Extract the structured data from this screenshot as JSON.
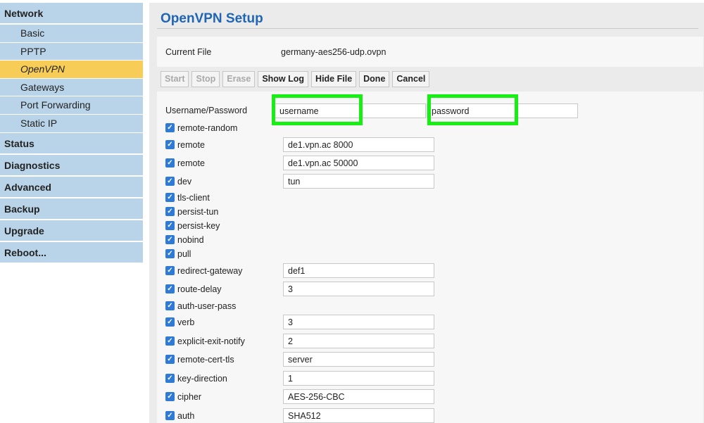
{
  "sidebar": {
    "network": "Network",
    "network_items": [
      {
        "label": "Basic"
      },
      {
        "label": "PPTP"
      },
      {
        "label": "OpenVPN"
      },
      {
        "label": "Gateways"
      },
      {
        "label": "Port Forwarding"
      },
      {
        "label": "Static IP"
      }
    ],
    "sections": [
      "Status",
      "Diagnostics",
      "Advanced",
      "Backup",
      "Upgrade",
      "Reboot..."
    ]
  },
  "page": {
    "title": "OpenVPN Setup"
  },
  "file": {
    "label": "Current File",
    "value": "germany-aes256-udp.ovpn"
  },
  "toolbar": {
    "start": "Start",
    "stop": "Stop",
    "erase": "Erase",
    "show_log": "Show Log",
    "hide_file": "Hide File",
    "done": "Done",
    "cancel": "Cancel"
  },
  "credentials": {
    "label": "Username/Password",
    "username": "username",
    "password": "password",
    "highlight_color": "#16ee14"
  },
  "options": [
    {
      "name": "remote-random",
      "value": null
    },
    {
      "name": "remote",
      "value": "de1.vpn.ac 8000"
    },
    {
      "name": "remote",
      "value": "de1.vpn.ac 50000"
    },
    {
      "name": "dev",
      "value": "tun"
    },
    {
      "name": "tls-client",
      "value": null
    },
    {
      "name": "persist-tun",
      "value": null
    },
    {
      "name": "persist-key",
      "value": null
    },
    {
      "name": "nobind",
      "value": null
    },
    {
      "name": "pull",
      "value": null
    },
    {
      "name": "redirect-gateway",
      "value": "def1"
    },
    {
      "name": "route-delay",
      "value": "3"
    },
    {
      "name": "auth-user-pass",
      "value": null
    },
    {
      "name": "verb",
      "value": "3"
    },
    {
      "name": "explicit-exit-notify",
      "value": "2"
    },
    {
      "name": "remote-cert-tls",
      "value": "server"
    },
    {
      "name": "key-direction",
      "value": "1"
    },
    {
      "name": "cipher",
      "value": "AES-256-CBC"
    },
    {
      "name": "auth",
      "value": "SHA512"
    }
  ],
  "colors": {
    "sidebar_bg": "#b9d4e9",
    "active_item": "#f7cc57",
    "title": "#1f65b3",
    "checkbox": "#2f7ad6"
  }
}
